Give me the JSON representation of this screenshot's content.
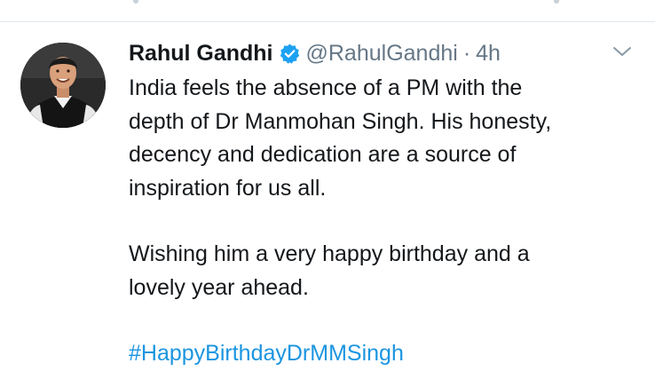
{
  "tweet": {
    "author_name": "Rahul Gandhi",
    "handle": "@RahulGandhi",
    "separator": "·",
    "time": "4h",
    "paragraph_1": "India feels the absence of a PM with the\ndepth of Dr Manmohan Singh. His honesty,\ndecency and dedication are a source of\ninspiration for us all.",
    "paragraph_2": "Wishing him a very happy birthday and a\nlovely year ahead.",
    "hashtag": "#HappyBirthdayDrMMSingh"
  },
  "icons": {
    "verified": "verified-badge-icon",
    "menu": "chevron-down-icon"
  },
  "colors": {
    "text": "#14171a",
    "secondary": "#657786",
    "link": "#1b95e0",
    "verified": "#1da1f2",
    "divider": "#e1e8ed"
  }
}
